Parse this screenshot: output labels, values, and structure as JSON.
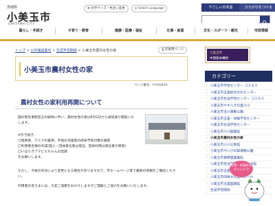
{
  "header": {
    "prefecture": "茨城県",
    "city_name": "小美玉市",
    "city_roman": "OMITAMA CITY",
    "text_size_label": "文字サイズ・色合い変更",
    "language_label": "Select Language",
    "easy_japanese_label": "やさしい日本語",
    "hiragana_label": "ひらがなをつける",
    "search_placeholder": "",
    "accent_color": "#d9a93b",
    "brand_color": "#2a3a7a"
  },
  "nav": {
    "items": [
      {
        "label": "暮らし・手続き"
      },
      {
        "label": "子育て・教育"
      },
      {
        "label": "健康・医療・福祉"
      },
      {
        "label": "仕事・産業"
      },
      {
        "label": "文化・スポーツ・観光"
      },
      {
        "label": "市政情報"
      }
    ]
  },
  "breadcrumb": {
    "items": [
      {
        "label": "トップ"
      },
      {
        "label": "公共施設案内"
      },
      {
        "label": "生涯学習関係"
      },
      {
        "label": "小美玉市農村女性の家"
      }
    ],
    "separator": ">"
  },
  "print_label": "印刷用ページ",
  "main": {
    "title": "小美玉市農村女性の家",
    "page_id": "ページ番号：P-000839",
    "section_heading": "農村女性の家利用再開について",
    "paragraphs": [
      "国の緊急事態宣言の解除に伴い、農村女性の家は6月1日から通常通り開館いた",
      "します。",
      "※引き続き、",
      "〇発熱等、マスクの着用、手指の消毒等の感染予防対策の徹底",
      "〇利用者名簿の作成(個人・団体責任者は提出、団体利用は責任者が保管)",
      "〇いばらきアマビエちゃんの登録",
      "をお願いします。",
      "ただし、今後の状況により変更となる場合がありますので、市ホームページ等で最新の情報をご確認くださ",
      "い。",
      "利用者の皆さまには、大変ご迷惑をおかけしますがご理解とご協力をお願いいたします。"
    ]
  },
  "sidebar": {
    "banner_line1": "小美玉市",
    "banner_line2": "中期基本構想",
    "category_heading": "カテゴリー",
    "items": [
      {
        "label": "小美玉市学習センター コスモス"
      },
      {
        "label": "小美玉市玉里総合文化センター"
      },
      {
        "label": "小美玉市生涯学習センター コスモス"
      },
      {
        "label": "小美玉市やすらぎの里小川"
      },
      {
        "label": "小美玉市玉川運動公園"
      },
      {
        "label": "小美玉市玉里・体験学習センター"
      },
      {
        "label": "小美玉市生涯学習センター"
      },
      {
        "label": "小美玉市小川図書館"
      },
      {
        "label": "小美玉市農村女性の家"
      },
      {
        "label": "小美玉市小川公民館"
      },
      {
        "label": "小美玉市やいびの森運動公園"
      },
      {
        "label": "小美玉市美野里図書館"
      },
      {
        "label": "小美玉市生涯学習ふれあい会館"
      },
      {
        "label": "小美玉市玉里運動公園"
      },
      {
        "label": "小美玉市四季文化館みの〜れ"
      },
      {
        "label": "小美玉市玉里図書館"
      },
      {
        "label": "生涯学習関係"
      }
    ],
    "current_index": 8,
    "mascot_bubble": "質問・お悩みをチャットで"
  }
}
